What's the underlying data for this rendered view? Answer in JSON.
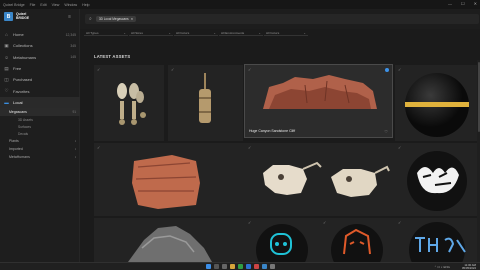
{
  "titlebar": {
    "title": "Quixel Bridge",
    "menus": [
      "File",
      "Edit",
      "View",
      "Window",
      "Help"
    ],
    "controls": [
      "—",
      "☐",
      "✕"
    ]
  },
  "logo": {
    "line1": "Quixel",
    "line2": "BRIDGE"
  },
  "sidebar": {
    "items": [
      {
        "label": "Home",
        "count": "12,345",
        "icon": "home-icon"
      },
      {
        "label": "Collections",
        "count": "345",
        "icon": "collections-icon"
      },
      {
        "label": "Metahumans",
        "count": "145",
        "icon": "metahuman-icon"
      },
      {
        "label": "Free",
        "count": "",
        "icon": "gift-icon"
      },
      {
        "label": "Purchased",
        "count": "",
        "icon": "cart-icon"
      },
      {
        "label": "Favorites",
        "count": "",
        "icon": "heart-icon"
      },
      {
        "label": "Local",
        "count": "",
        "icon": "folder-icon"
      }
    ],
    "local_sub": [
      {
        "label": "Megascans",
        "count": "91"
      }
    ],
    "megascans_sub": [
      "3D Assets",
      "Surfaces",
      "Decals"
    ],
    "bottom": [
      {
        "label": "Plants",
        "count": ""
      },
      {
        "label": "Imported",
        "count": ""
      },
      {
        "label": "MetaHumans",
        "count": ""
      }
    ]
  },
  "search": {
    "chip": "3D Local Megascans"
  },
  "filters": [
    "All Types",
    "All Sizes",
    "All Colors",
    "All Environments",
    "All Colors"
  ],
  "section_title": "LATEST ASSETS",
  "selected_asset": {
    "name": "Huge Canyon Sandstone Cliff"
  },
  "taskbar": {
    "time": "11:00 AM",
    "date": "05/05/2022",
    "lang": "ENG"
  }
}
